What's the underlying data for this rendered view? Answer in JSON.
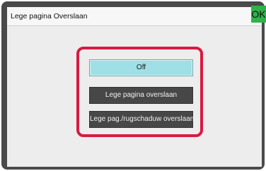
{
  "dialog": {
    "title": "Lege pagina Overslaan",
    "ok_label": "OK"
  },
  "options": [
    {
      "label": "Off",
      "selected": true
    },
    {
      "label": "Lege pagina overslaan",
      "selected": false
    },
    {
      "label": "Lege pag./rugschaduw overslaan",
      "selected": false
    }
  ],
  "colors": {
    "ok_button": "#2fb24a",
    "highlight_border": "#d91a41",
    "selected_option": "#9fdfe6",
    "unselected_option": "#474747"
  }
}
